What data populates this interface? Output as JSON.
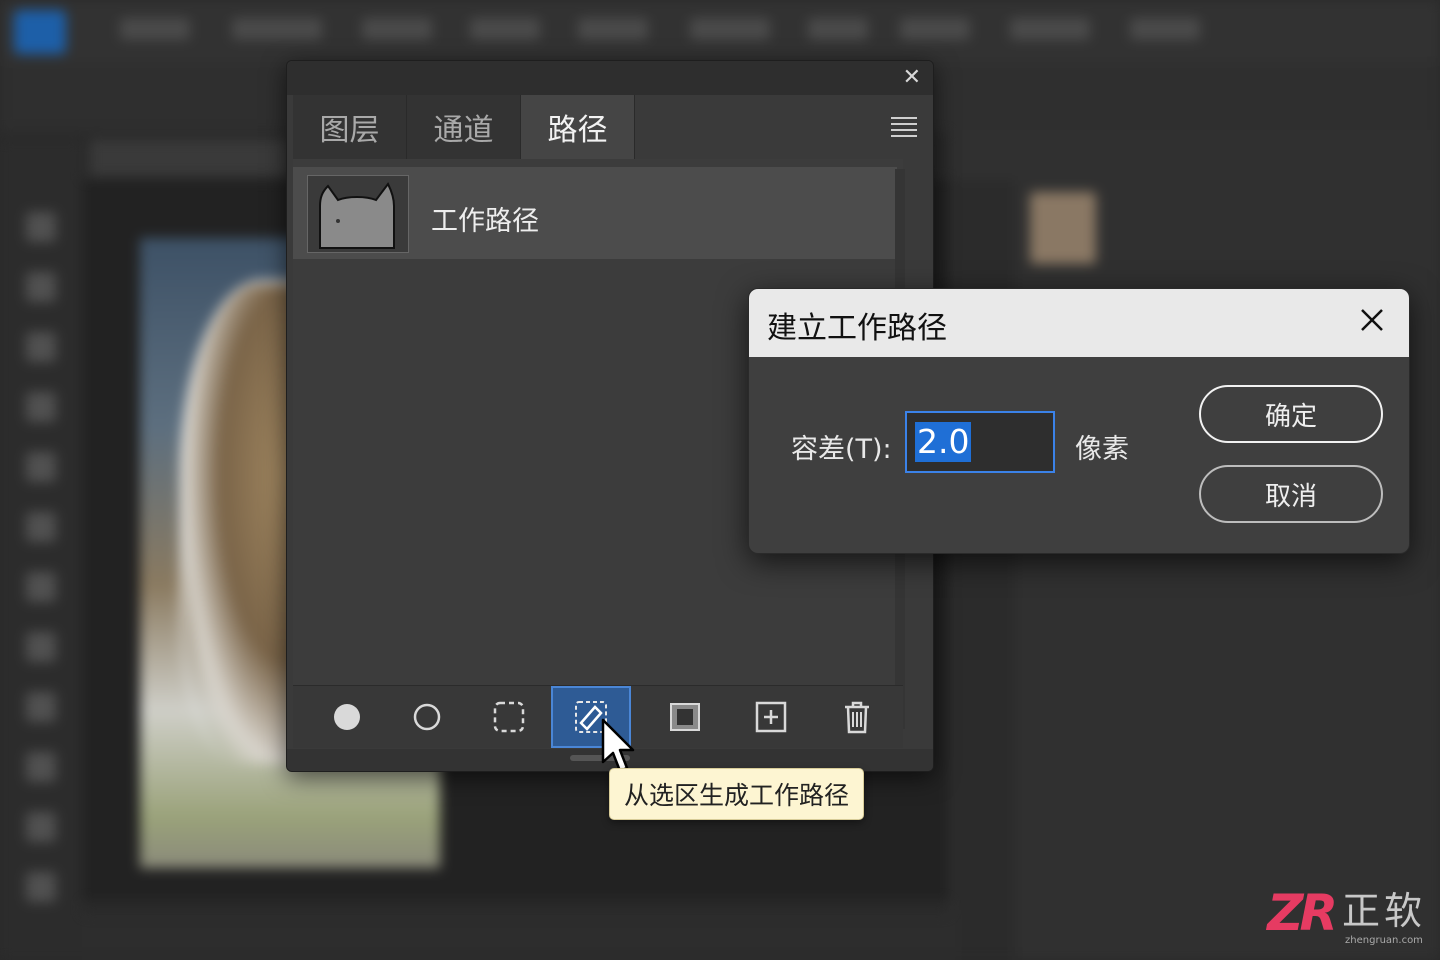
{
  "paths_panel": {
    "tabs": [
      {
        "label": "图层"
      },
      {
        "label": "通道"
      },
      {
        "label": "路径"
      }
    ],
    "active_tab": "路径",
    "path_items": [
      {
        "name": "工作路径"
      }
    ],
    "footer_buttons": [
      {
        "icon": "fill-path-icon"
      },
      {
        "icon": "stroke-path-icon"
      },
      {
        "icon": "load-as-selection-icon"
      },
      {
        "icon": "make-work-path-icon"
      },
      {
        "icon": "add-mask-icon"
      },
      {
        "icon": "new-path-icon"
      },
      {
        "icon": "delete-path-icon"
      }
    ],
    "tooltip": "从选区生成工作路径"
  },
  "make_work_path_dialog": {
    "title": "建立工作路径",
    "tolerance_label": "容差(T):",
    "tolerance_value": "2.0",
    "unit": "像素",
    "ok_label": "确定",
    "cancel_label": "取消"
  },
  "watermark": {
    "logo": "ZR",
    "name": "正软",
    "url": "zhengruan.com"
  },
  "colors": {
    "accent": "#2e5b95",
    "input_border": "#3b82e8",
    "tooltip_bg": "#fdf5d2",
    "watermark_logo": "#e63b62"
  }
}
